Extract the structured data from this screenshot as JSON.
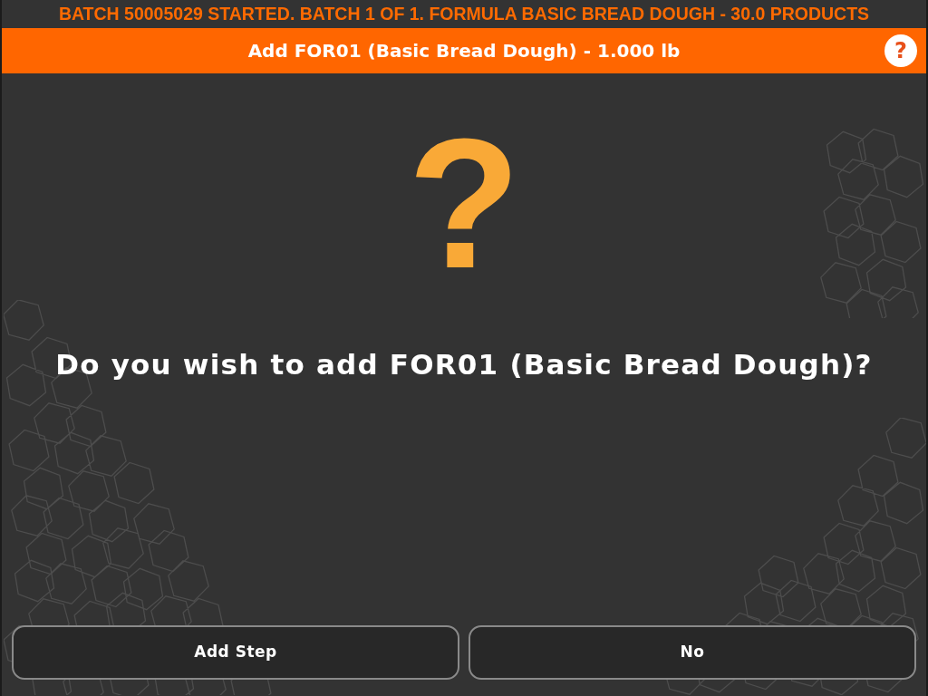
{
  "status_banner": "BATCH 50005029 STARTED. BATCH 1 OF 1. FORMULA BASIC BREAD DOUGH - 30.0 PRODUCTS",
  "dialog": {
    "title": "Add FOR01 (Basic Bread Dough) - 1.000 lb",
    "help_button": "?",
    "prompt_icon": "?",
    "message": "Do you wish to add FOR01 (Basic Bread Dough)?"
  },
  "buttons": [
    "Add Step",
    "No"
  ]
}
